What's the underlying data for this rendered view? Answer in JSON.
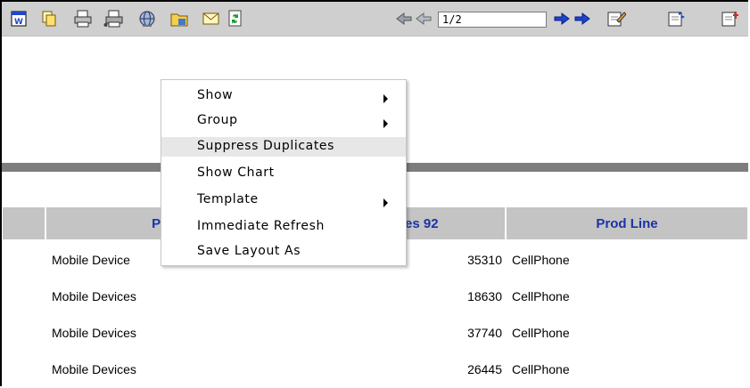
{
  "toolbar": {
    "icons": [
      "word-export-icon",
      "copy-icon",
      "print-icon",
      "print-setup-icon",
      "globe-icon",
      "folder-icon",
      "email-icon",
      "refresh-icon"
    ],
    "nav": {
      "first": "first-page-icon",
      "prev": "previous-page-icon",
      "page_value": "1/2",
      "next": "next-page-icon",
      "last": "last-page-icon"
    },
    "right_icons": [
      "edit-report-icon",
      "edit-query-icon",
      "export-settings-icon"
    ],
    "colors": {
      "background": "#cfcfcf",
      "nav_arrow": "#1b43d4"
    }
  },
  "table": {
    "headers": [
      "Pr",
      "es 92",
      "Prod Line"
    ],
    "rows": [
      {
        "product": "Mobile Device",
        "sales": "35310",
        "line": "CellPhone"
      },
      {
        "product": "Mobile Devices",
        "sales": "18630",
        "line": "CellPhone"
      },
      {
        "product": "Mobile Devices",
        "sales": "37740",
        "line": "CellPhone"
      },
      {
        "product": "Mobile Devices",
        "sales": "26445",
        "line": "CellPhone"
      }
    ],
    "header_color": "#1a33a8",
    "header_bg": "#c4c4c4"
  },
  "context_menu": {
    "items": [
      {
        "label": "Show",
        "submenu": true
      },
      {
        "label": "Group",
        "submenu": true
      },
      {
        "label": "Suppress Duplicates",
        "submenu": false,
        "highlighted": true
      },
      {
        "label": "Show Chart",
        "submenu": false
      },
      {
        "label": "Template",
        "submenu": true
      },
      {
        "label": "Immediate Refresh",
        "submenu": false
      },
      {
        "label": "Save Layout As",
        "submenu": false
      }
    ]
  }
}
